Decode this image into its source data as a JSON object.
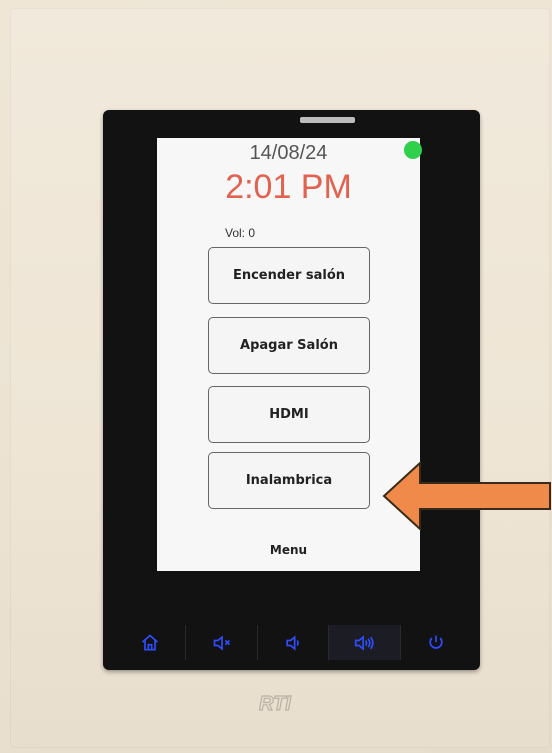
{
  "screen": {
    "date": "14/08/24",
    "time": "2:01 PM",
    "volume_label": "Vol: 0",
    "buttons": [
      {
        "label": "Encender salón"
      },
      {
        "label": "Apagar Salón"
      },
      {
        "label": "HDMI"
      },
      {
        "label": "Inalambrica"
      }
    ],
    "menu_label": "Menu"
  },
  "softkeys": [
    "home-icon",
    "mute-icon",
    "volume-down-icon",
    "volume-up-icon",
    "power-icon"
  ],
  "brand": "RTI",
  "colors": {
    "time": "#e2624f",
    "status": "#2fd04c",
    "softkey_icons": "#2f4dff",
    "arrow": "#f08a4b"
  }
}
